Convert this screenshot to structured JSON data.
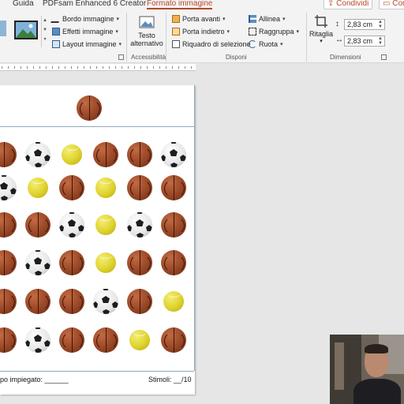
{
  "ribbon_tabs": {
    "guida": "Guida",
    "pdfsam": "PDFsam Enhanced 6 Creator",
    "formato_immagine": "Formato immagine",
    "share": "Condividi",
    "comments": "Com"
  },
  "ribbon": {
    "bordo_immagine": "Bordo immagine",
    "effetti_immagine": "Effetti immagine",
    "layout_immagine": "Layout immagine",
    "testo_alternativo_line1": "Testo",
    "testo_alternativo_line2": "alternativo",
    "accessibilita": "Accessibilità",
    "porta_avanti": "Porta avanti",
    "porta_indietro": "Porta indietro",
    "riquadro_selezione": "Riquadro di selezione",
    "allinea": "Allinea",
    "raggruppa": "Raggruppa",
    "ruota": "Ruota",
    "disponi": "Disponi",
    "ritaglia": "Ritaglia",
    "height_value": "2,83 cm",
    "width_value": "2,83 cm",
    "dimensioni": "Dimensioni"
  },
  "slide": {
    "grid": [
      [
        "basketball",
        "soccer",
        "tennis",
        "basketball",
        "basketball",
        "soccer"
      ],
      [
        "soccer",
        "tennis",
        "basketball",
        "tennis",
        "basketball",
        "basketball"
      ],
      [
        "basketball",
        "basketball",
        "soccer",
        "tennis",
        "soccer",
        "basketball"
      ],
      [
        "basketball",
        "soccer",
        "basketball",
        "tennis",
        "basketball",
        "basketball"
      ],
      [
        "basketball",
        "basketball",
        "basketball",
        "soccer",
        "basketball",
        "tennis"
      ],
      [
        "basketball",
        "soccer",
        "basketball",
        "basketball",
        "tennis",
        "basketball"
      ]
    ],
    "target": "basketball",
    "footer_left": "po impiegato: ______",
    "footer_right": "Stimoli: __/10"
  }
}
